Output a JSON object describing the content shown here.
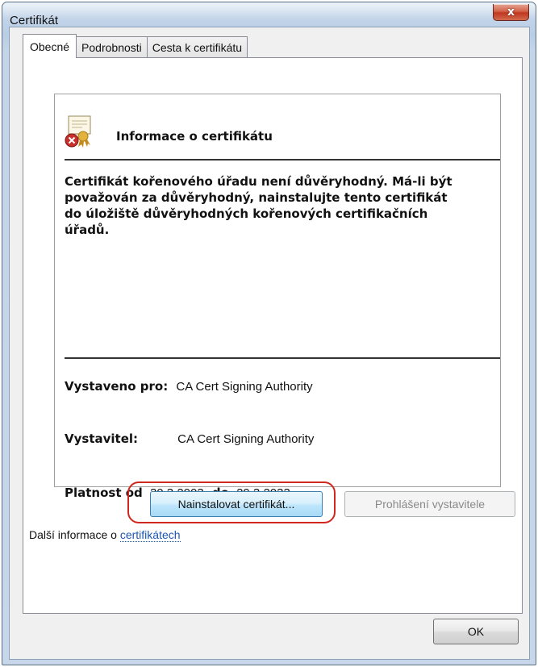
{
  "window": {
    "title": "Certifikát",
    "close_label": "x"
  },
  "tabs": [
    {
      "label": "Obecné",
      "active": true
    },
    {
      "label": "Podrobnosti",
      "active": false
    },
    {
      "label": "Cesta k certifikátu",
      "active": false
    }
  ],
  "info": {
    "icon": "certificate-error-icon",
    "title": "Informace o certifikátu",
    "warning": "Certifikát kořenového úřadu není důvěryhodný. Má-li být považován za důvěryhodný, nainstalujte tento certifikát do úložiště důvěryhodných kořenových certifikačních úřadů.",
    "issued_to_label": "Vystaveno pro:",
    "issued_to_value": "CA Cert Signing Authority",
    "issuer_label": "Vystavitel:",
    "issuer_value": "CA Cert Signing Authority",
    "valid_from_label": "Platnost od",
    "valid_from_value": "30.3.2003",
    "valid_to_label": "do",
    "valid_to_value": "29.3.2033"
  },
  "buttons": {
    "install": "Nainstalovat certifikát...",
    "issuer_statement": "Prohlášení vystavitele",
    "ok": "OK"
  },
  "more_info": {
    "prefix": "Další informace o ",
    "link": "certifikátech"
  },
  "colors": {
    "highlight": "#d0271f",
    "link": "#1c56b0"
  }
}
